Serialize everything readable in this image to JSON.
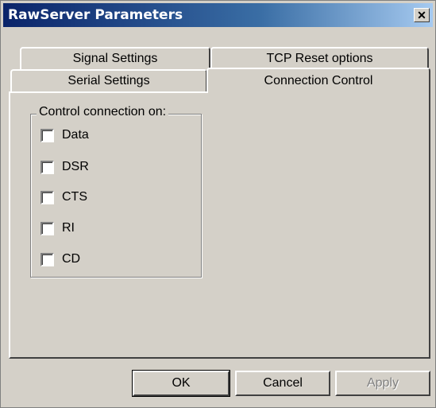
{
  "window": {
    "title": "RawServer Parameters",
    "close_glyph": "✕"
  },
  "tabs": {
    "row1": [
      "Signal Settings",
      "TCP Reset options"
    ],
    "row2": [
      "Serial Settings",
      "Connection Control"
    ],
    "active": "Connection Control"
  },
  "group": {
    "label": "Control connection on:",
    "options": [
      {
        "label": "Data",
        "checked": false
      },
      {
        "label": "DSR",
        "checked": false
      },
      {
        "label": "CTS",
        "checked": false
      },
      {
        "label": "RI",
        "checked": false
      },
      {
        "label": "CD",
        "checked": false
      }
    ]
  },
  "buttons": {
    "ok": "OK",
    "cancel": "Cancel",
    "apply": "Apply",
    "apply_enabled": false
  }
}
